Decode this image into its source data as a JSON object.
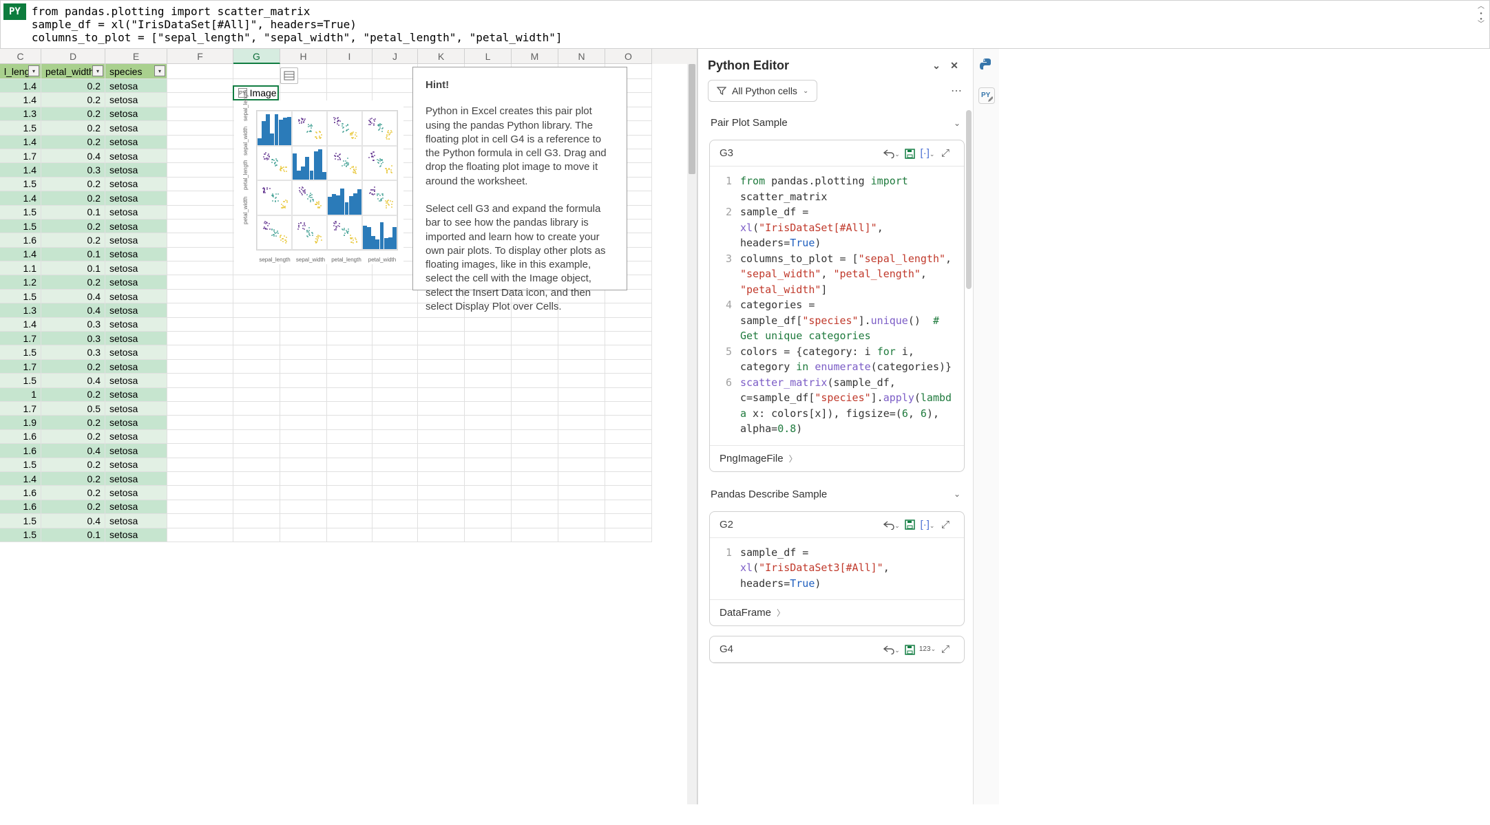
{
  "formula_bar": {
    "py_badge": "PY",
    "code": "from pandas.plotting import scatter_matrix\nsample_df = xl(\"IrisDataSet[#All]\", headers=True)\ncolumns_to_plot = [\"sepal_length\", \"sepal_width\", \"petal_length\", \"petal_width\"]"
  },
  "columns": [
    "C",
    "D",
    "E",
    "F",
    "G",
    "H",
    "I",
    "J",
    "K",
    "L",
    "M",
    "N",
    "O"
  ],
  "selected_column": "G",
  "table": {
    "headers": [
      "l_lengtl",
      "petal_width",
      "species"
    ],
    "rows": [
      [
        1.4,
        0.2,
        "setosa"
      ],
      [
        1.4,
        0.2,
        "setosa"
      ],
      [
        1.3,
        0.2,
        "setosa"
      ],
      [
        1.5,
        0.2,
        "setosa"
      ],
      [
        1.4,
        0.2,
        "setosa"
      ],
      [
        1.7,
        0.4,
        "setosa"
      ],
      [
        1.4,
        0.3,
        "setosa"
      ],
      [
        1.5,
        0.2,
        "setosa"
      ],
      [
        1.4,
        0.2,
        "setosa"
      ],
      [
        1.5,
        0.1,
        "setosa"
      ],
      [
        1.5,
        0.2,
        "setosa"
      ],
      [
        1.6,
        0.2,
        "setosa"
      ],
      [
        1.4,
        0.1,
        "setosa"
      ],
      [
        1.1,
        0.1,
        "setosa"
      ],
      [
        1.2,
        0.2,
        "setosa"
      ],
      [
        1.5,
        0.4,
        "setosa"
      ],
      [
        1.3,
        0.4,
        "setosa"
      ],
      [
        1.4,
        0.3,
        "setosa"
      ],
      [
        1.7,
        0.3,
        "setosa"
      ],
      [
        1.5,
        0.3,
        "setosa"
      ],
      [
        1.7,
        0.2,
        "setosa"
      ],
      [
        1.5,
        0.4,
        "setosa"
      ],
      [
        1,
        0.2,
        "setosa"
      ],
      [
        1.7,
        0.5,
        "setosa"
      ],
      [
        1.9,
        0.2,
        "setosa"
      ],
      [
        1.6,
        0.2,
        "setosa"
      ],
      [
        1.6,
        0.4,
        "setosa"
      ],
      [
        1.5,
        0.2,
        "setosa"
      ],
      [
        1.4,
        0.2,
        "setosa"
      ],
      [
        1.6,
        0.2,
        "setosa"
      ],
      [
        1.6,
        0.2,
        "setosa"
      ],
      [
        1.5,
        0.4,
        "setosa"
      ],
      [
        1.5,
        0.1,
        "setosa"
      ]
    ]
  },
  "selected_cell": {
    "ref": "G3",
    "label": "Image"
  },
  "plot": {
    "axes": [
      "sepal_length",
      "sepal_width",
      "petal_length",
      "petal_width"
    ]
  },
  "hint": {
    "title": "Hint!",
    "p1": "Python in Excel creates this pair plot using the pandas Python library. The floating plot in cell G4 is a reference to the Python formula in cell G3. Drag and drop the floating plot image to move it around the worksheet.",
    "p2": "Select cell G3 and expand the formula bar to see how the pandas library is imported and learn how to create your own pair plots. To display other plots as floating images, like in this example, select the cell with the Image object, select the Insert Data icon, and then select Display Plot over Cells."
  },
  "editor": {
    "title": "Python Editor",
    "filter_label": "All Python cells",
    "sections": {
      "pair": "Pair Plot Sample",
      "describe": "Pandas Describe Sample"
    },
    "card1": {
      "ref": "G3",
      "output": "PngImageFile",
      "code": [
        {
          "n": "1",
          "h": "<span class='kw'>from</span> pandas.plotting <span class='kw'>import</span> scatter_matrix"
        },
        {
          "n": "2",
          "h": "sample_df = <span class='fn'>xl</span>(<span class='str'>\"IrisDataSet[#All]\"</span>, headers=<span class='bool'>True</span>)"
        },
        {
          "n": "3",
          "h": "columns_to_plot = [<span class='str'>\"sepal_length\"</span>, <span class='str'>\"sepal_width\"</span>, <span class='str'>\"petal_length\"</span>, <span class='str'>\"petal_width\"</span>]"
        },
        {
          "n": "4",
          "h": "categories = sample_df[<span class='str'>\"species\"</span>].<span class='fn'>unique</span>()  <span class='cm'># Get unique categories</span>"
        },
        {
          "n": "5",
          "h": "colors = {category: i <span class='kw'>for</span> i, category <span class='kw'>in</span> <span class='fn'>enumerate</span>(categories)}"
        },
        {
          "n": "6",
          "h": "<span class='fn'>scatter_matrix</span>(sample_df, c=sample_df[<span class='str'>\"species\"</span>].<span class='fn'>apply</span>(<span class='kw'>lambda</span> x: colors[x]), figsize=(<span class='num'>6</span>, <span class='num'>6</span>), alpha=<span class='num'>0.8</span>)"
        }
      ]
    },
    "card2": {
      "ref": "G2",
      "output": "DataFrame",
      "code": [
        {
          "n": "1",
          "h": "sample_df = <span class='fn'>xl</span>(<span class='str'>\"IrisDataSet3[#All]\"</span>, headers=<span class='bool'>True</span>)"
        }
      ]
    },
    "card3": {
      "ref": "G4",
      "output_mode": "123"
    }
  }
}
